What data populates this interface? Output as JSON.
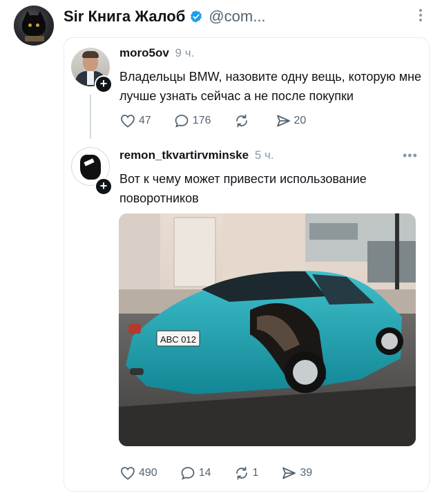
{
  "header": {
    "display_name": "Sir Книга Жалоб",
    "handle": "@com..."
  },
  "quoted_post": {
    "username": "moro5ov",
    "time": "9 ч.",
    "text": "Владельцы BMW, назовите одну вещь, которую мне лучше узнать сейчас а не после покупки",
    "likes": "47",
    "replies": "176",
    "reposts": "",
    "shares": "20"
  },
  "reply_post": {
    "username": "remon_tkvartirvminske",
    "time": "5 ч.",
    "text": "Вот к чему может привести использование поворотников",
    "plate": "ABC 012",
    "likes": "490",
    "replies": "14",
    "reposts": "1",
    "shares": "39"
  },
  "icons": [
    "verified-icon",
    "more-vertical-icon",
    "more-horizontal-icon",
    "heart-icon",
    "comment-icon",
    "repost-icon",
    "share-icon",
    "plus-icon"
  ],
  "colors": {
    "verified": "#1d9bf0",
    "car": "#1fa6b4",
    "text": "#0f1419",
    "muted": "#536471"
  }
}
